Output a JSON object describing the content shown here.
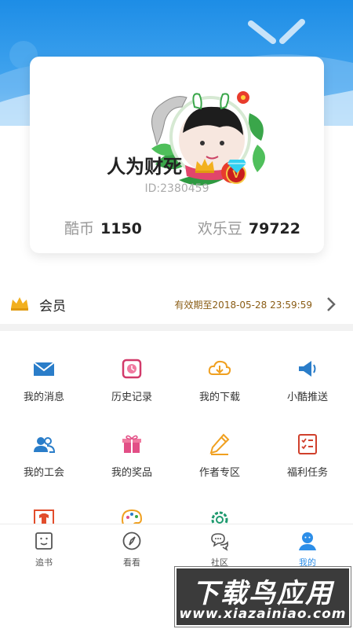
{
  "profile": {
    "name": "人为财死",
    "id_text": "ID:2380459",
    "vip_badge": "V",
    "stats": [
      {
        "label": "酷币",
        "value": "1150"
      },
      {
        "label": "欢乐豆",
        "value": "79722"
      }
    ]
  },
  "member": {
    "label": "会员",
    "expiry": "有效期至2018-05-28 23:59:59"
  },
  "grid": [
    {
      "label": "我的消息",
      "icon": "envelope-icon"
    },
    {
      "label": "历史记录",
      "icon": "history-icon"
    },
    {
      "label": "我的下载",
      "icon": "download-cloud-icon"
    },
    {
      "label": "小酷推送",
      "icon": "megaphone-icon"
    },
    {
      "label": "我的工会",
      "icon": "group-icon"
    },
    {
      "label": "我的奖品",
      "icon": "gift-icon"
    },
    {
      "label": "作者专区",
      "icon": "pencil-icon"
    },
    {
      "label": "福利任务",
      "icon": "task-list-icon"
    },
    {
      "label": "",
      "icon": "shirt-icon"
    },
    {
      "label": "",
      "icon": "palette-icon"
    },
    {
      "label": "",
      "icon": "settings-gear-icon"
    }
  ],
  "tabs": [
    {
      "label": "追书",
      "icon": "follow-books-icon"
    },
    {
      "label": "看看",
      "icon": "compass-icon"
    },
    {
      "label": "社区",
      "icon": "chat-bubbles-icon"
    },
    {
      "label": "我的",
      "icon": "profile-icon",
      "active": true
    }
  ],
  "watermark": {
    "main": "下载鸟应用",
    "url": "www.xiazainiao.com"
  },
  "colors": {
    "header_blue": "#1d8de6",
    "accent_blue": "#2c8ee8",
    "expiry_brown": "#8a5c14",
    "crown_gold": "#f2b01e"
  }
}
